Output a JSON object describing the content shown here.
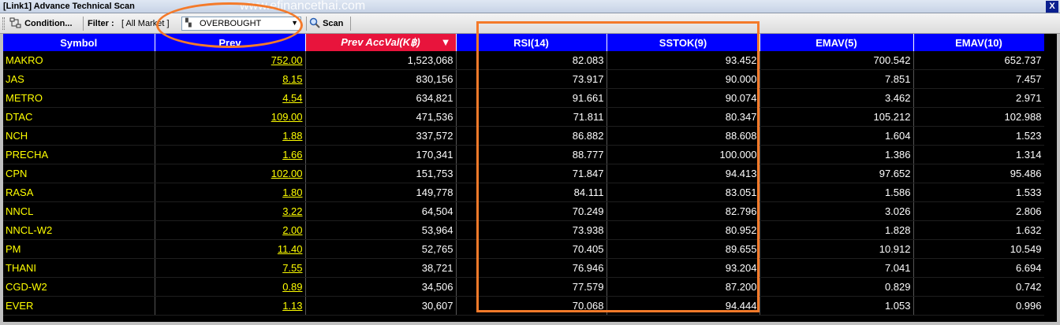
{
  "window": {
    "title": "[Link1] Advance Technical Scan",
    "watermark": "www.efinancethai.com",
    "close_label": "X"
  },
  "toolbar": {
    "condition_label": "Condition...",
    "filter_label": "Filter :",
    "filter_value": "[ All Market ]",
    "scan_type": "OVERBOUGHT",
    "scan_label": "Scan"
  },
  "icons": {
    "condition": "condition-icon",
    "scan_type": "chart-icon",
    "scan": "magnifier-icon",
    "sort": "sort-descending-icon"
  },
  "colors": {
    "header_bg": "#0000ff",
    "sorted_header_bg": "#e8143c",
    "symbol_text": "#ffff00",
    "highlight": "#f47a2a"
  },
  "grid": {
    "columns": [
      "Symbol",
      "Prev",
      "Prev AccVal(K฿)",
      "RSI(14)",
      "SSTOK(9)",
      "EMAV(5)",
      "EMAV(10)"
    ],
    "sorted_column_index": 2,
    "rows": [
      [
        "MAKRO",
        "752.00",
        "1,523,068",
        "82.083",
        "93.452",
        "700.542",
        "652.737"
      ],
      [
        "JAS",
        "8.15",
        "830,156",
        "73.917",
        "90.000",
        "7.851",
        "7.457"
      ],
      [
        "METRO",
        "4.54",
        "634,821",
        "91.661",
        "90.074",
        "3.462",
        "2.971"
      ],
      [
        "DTAC",
        "109.00",
        "471,536",
        "71.811",
        "80.347",
        "105.212",
        "102.988"
      ],
      [
        "NCH",
        "1.88",
        "337,572",
        "86.882",
        "88.608",
        "1.604",
        "1.523"
      ],
      [
        "PRECHA",
        "1.66",
        "170,341",
        "88.777",
        "100.000",
        "1.386",
        "1.314"
      ],
      [
        "CPN",
        "102.00",
        "151,753",
        "71.847",
        "94.413",
        "97.652",
        "95.486"
      ],
      [
        "RASA",
        "1.80",
        "149,778",
        "84.111",
        "83.051",
        "1.586",
        "1.533"
      ],
      [
        "NNCL",
        "3.22",
        "64,504",
        "70.249",
        "82.796",
        "3.026",
        "2.806"
      ],
      [
        "NNCL-W2",
        "2.00",
        "53,964",
        "73.938",
        "80.952",
        "1.828",
        "1.632"
      ],
      [
        "PM",
        "11.40",
        "52,765",
        "70.405",
        "89.655",
        "10.912",
        "10.549"
      ],
      [
        "THANI",
        "7.55",
        "38,721",
        "76.946",
        "93.204",
        "7.041",
        "6.694"
      ],
      [
        "CGD-W2",
        "0.89",
        "34,506",
        "77.579",
        "87.200",
        "0.829",
        "0.742"
      ],
      [
        "EVER",
        "1.13",
        "30,607",
        "70.068",
        "94.444",
        "1.053",
        "0.996"
      ]
    ]
  }
}
